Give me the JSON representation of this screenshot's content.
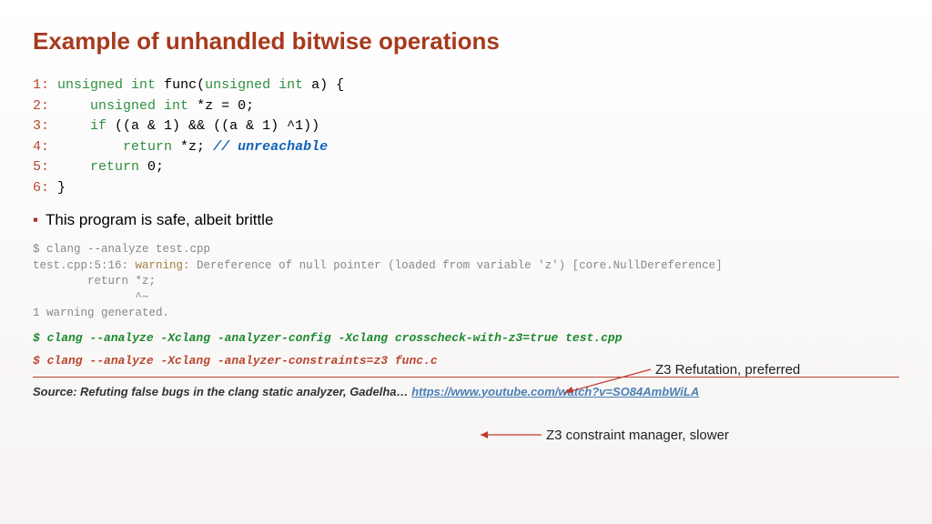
{
  "title": "Example of unhandled bitwise operations",
  "code": {
    "l1": {
      "n": "1:",
      "a": "unsigned int",
      "b": " func(",
      "c": "unsigned int",
      "d": " a) {"
    },
    "l2": {
      "n": "2:",
      "a": "unsigned int",
      "b": " *z = 0;"
    },
    "l3": {
      "n": "3:",
      "a": "if",
      "b": " ((a & 1) && ((a & 1) ^1))"
    },
    "l4": {
      "n": "4:",
      "a": "return",
      "b": " *z; ",
      "c": "// unreachable"
    },
    "l5": {
      "n": "5:",
      "a": "return",
      "b": " 0;"
    },
    "l6": {
      "n": "6:",
      "a": "}"
    }
  },
  "bullet1": "This program is safe, albeit brittle",
  "term": {
    "l1": "$ clang --analyze test.cpp",
    "l2a": "test.cpp:5:16: ",
    "l2b": "warning:",
    "l2c": " Dereference of null pointer (loaded from variable 'z') [core.NullDereference]",
    "l3": "        return *z;",
    "l4": "               ^~",
    "l5": "1 warning generated."
  },
  "cmd1": "$ clang --analyze -Xclang -analyzer-config -Xclang crosscheck-with-z3=true test.cpp",
  "cmd2": "$ clang --analyze  -Xclang -analyzer-constraints=z3 func.c",
  "annot1": "Z3 Refutation, preferred",
  "annot2": "Z3 constraint manager, slower",
  "source_label": "Source: Refuting false bugs in the clang static analyzer, Gadelha… ",
  "source_link": "https://www.youtube.com/watch?v=SO84AmbWiLA"
}
